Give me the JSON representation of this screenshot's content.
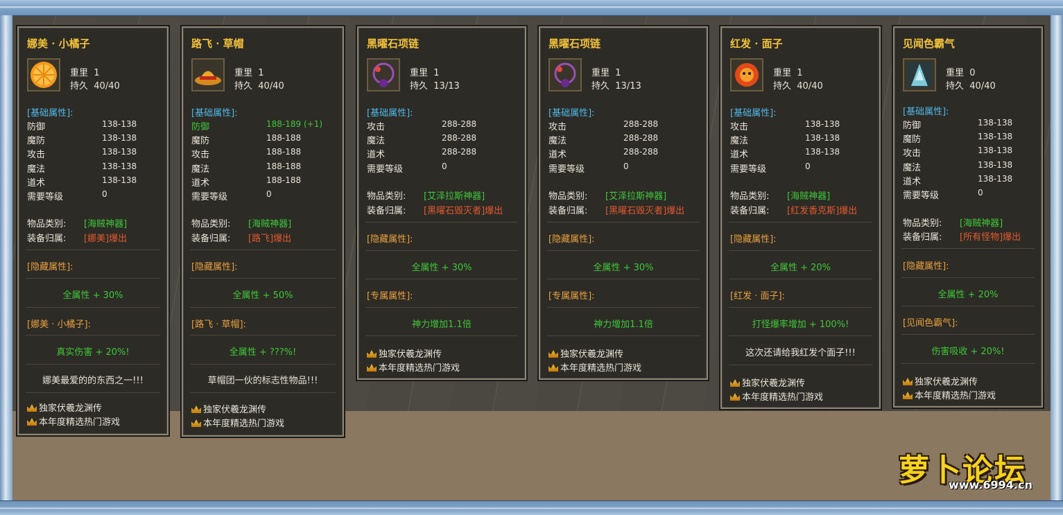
{
  "labels": {
    "weight": "重里",
    "durability": "持久",
    "base_attrs": "[基础属性]:",
    "item_type": "物品类别:",
    "equip_owner": "装备归属:",
    "hidden_attrs": "[隐藏属性]:",
    "exclusive_attrs": "[专属属性]:",
    "promo1": "独家伏羲龙渊传",
    "promo2": "本年度精选热门游戏"
  },
  "cards": [
    {
      "title": "娜美 · 小橘子",
      "weight": "1",
      "durability": "40/40",
      "stats": [
        {
          "k": "防御",
          "v": "138-138"
        },
        {
          "k": "魔防",
          "v": "138-138"
        },
        {
          "k": "攻击",
          "v": "138-138"
        },
        {
          "k": "魔法",
          "v": "138-138"
        },
        {
          "k": "道术",
          "v": "138-138"
        },
        {
          "k": "需要等级",
          "v": "0"
        }
      ],
      "type_value": "[海贼神器]",
      "owner_value": "[娜美]爆出",
      "hidden_value": "全属性 + 30%",
      "special_header": "[娜美 · 小橘子]:",
      "special_value": "真实伤害 + 20%!",
      "flavor": "娜美最爱的的东西之一!!!"
    },
    {
      "title": "路飞 · 草帽",
      "weight": "1",
      "durability": "40/40",
      "stats": [
        {
          "k": "防御",
          "v": "188-189 (+1)"
        },
        {
          "k": "魔防",
          "v": "188-188"
        },
        {
          "k": "攻击",
          "v": "188-188"
        },
        {
          "k": "魔法",
          "v": "188-188"
        },
        {
          "k": "道术",
          "v": "188-188"
        },
        {
          "k": "需要等级",
          "v": "0"
        }
      ],
      "type_value": "[海贼神器]",
      "owner_value": "[路飞]爆出",
      "hidden_value": "全属性 + 50%",
      "special_header": "[路飞 · 草帽]:",
      "special_value": "全属性 + ???%!",
      "flavor": "草帽团一伙的标志性物品!!!"
    },
    {
      "title": "黑曜石项链",
      "weight": "1",
      "durability": "13/13",
      "stats": [
        {
          "k": "攻击",
          "v": "288-288"
        },
        {
          "k": "魔法",
          "v": "288-288"
        },
        {
          "k": "道术",
          "v": "288-288"
        },
        {
          "k": "需要等级",
          "v": "0"
        }
      ],
      "type_value": "[艾泽拉斯神器]",
      "owner_value": "[黑曜石毁灭者]爆出",
      "hidden_value": "全属性 + 30%",
      "special_value": "神力增加1.1倍"
    },
    {
      "title": "黑曜石项链",
      "weight": "1",
      "durability": "13/13",
      "stats": [
        {
          "k": "攻击",
          "v": "288-288"
        },
        {
          "k": "魔法",
          "v": "288-288"
        },
        {
          "k": "道术",
          "v": "288-288"
        },
        {
          "k": "需要等级",
          "v": "0"
        }
      ],
      "type_value": "[艾泽拉斯神器]",
      "owner_value": "[黑曜石毁灭者]爆出",
      "hidden_value": "全属性 + 30%",
      "special_value": "神力增加1.1倍"
    },
    {
      "title": "红发 · 面子",
      "weight": "1",
      "durability": "40/40",
      "stats": [
        {
          "k": "攻击",
          "v": "138-138"
        },
        {
          "k": "魔法",
          "v": "138-138"
        },
        {
          "k": "道术",
          "v": "138-138"
        },
        {
          "k": "需要等级",
          "v": "0"
        }
      ],
      "type_value": "[海贼神器]",
      "owner_value": "[红发香克斯]爆出",
      "hidden_value": "全属性 + 20%",
      "special_header": "[红发 · 面子]:",
      "special_value": "打怪爆率增加 + 100%!",
      "flavor": "这次还请给我红发个面子!!!"
    },
    {
      "title": "见闻色霸气",
      "weight": "0",
      "durability": "40/40",
      "stats": [
        {
          "k": "防御",
          "v": "138-138"
        },
        {
          "k": "魔防",
          "v": "138-138"
        },
        {
          "k": "攻击",
          "v": "138-138"
        },
        {
          "k": "魔法",
          "v": "138-138"
        },
        {
          "k": "道术",
          "v": "138-138"
        },
        {
          "k": "需要等级",
          "v": "0"
        }
      ],
      "type_value": "[海贼神器]",
      "owner_value": "[所有怪物]爆出",
      "hidden_value": "全属性 + 20%",
      "special_header": "[见闻色霸气]:",
      "special_value": "伤害吸收 + 20%!"
    }
  ],
  "logo": {
    "text": "萝卜论坛",
    "url": "www.6994.cn"
  }
}
